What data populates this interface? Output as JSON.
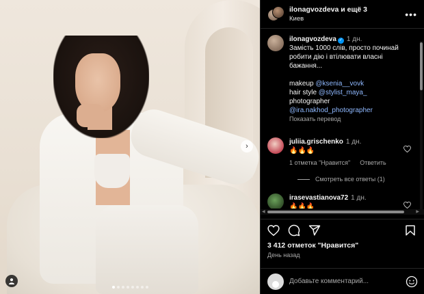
{
  "header": {
    "username": "ilonagvozdeva и ещё 3",
    "location": "Киев",
    "more_icon": "more-horizontal-icon"
  },
  "caption": {
    "username": "ilonagvozdeva",
    "time": "1 дн.",
    "text": "Замість 1000 слів, просто починай робити дію і втілювати власні бажання...",
    "makeup_label": "makeup",
    "makeup_link": "@ksenia__vovk",
    "hair_label": "hair style",
    "hair_link": "@stylist_maya_",
    "photographer_label": "photographer",
    "photographer_link": "@ira.nakhod_photographer",
    "translate": "Показать перевод"
  },
  "comments": [
    {
      "username": "juliia.grischenko",
      "time": "1 дн.",
      "text": "🔥🔥🔥",
      "likes_label": "1 отметка \"Нравится\"",
      "reply_label": "Ответить",
      "view_replies": "Смотреть все ответы (1)"
    },
    {
      "username": "irasevastianova72",
      "time": "1 дн.",
      "text": "🔥🔥🔥"
    }
  ],
  "actions": {
    "like_icon": "heart-icon",
    "comment_icon": "comment-icon",
    "share_icon": "send-icon",
    "save_icon": "bookmark-icon"
  },
  "likes": "3 412 отметок \"Нравится\"",
  "date": "День назад",
  "add_comment": {
    "placeholder": "Добавьте комментарий...",
    "emoji_icon": "emoji-icon"
  },
  "carousel": {
    "slide_count": 8,
    "active_index": 0
  },
  "colors": {
    "background": "#000000",
    "link": "#8fb9ff",
    "verified": "#0095f6",
    "muted": "#a8a8a8"
  }
}
